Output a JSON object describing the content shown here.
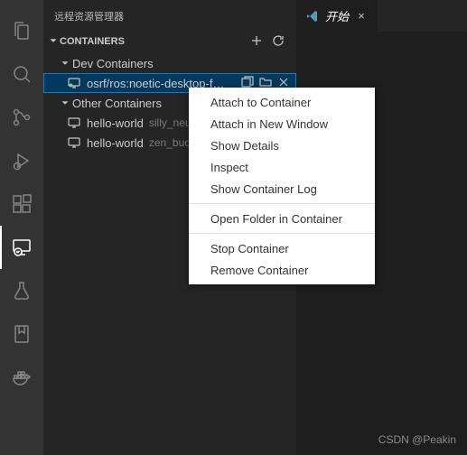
{
  "sidebar_title": "远程资源管理器",
  "section": {
    "title": "CONTAINERS",
    "groups": [
      {
        "label": "Dev Containers"
      },
      {
        "label": "Other Containers"
      }
    ],
    "dev_items": [
      {
        "label": "osrf/ros:noetic-desktop-f…"
      }
    ],
    "other_items": [
      {
        "label": "hello-world",
        "desc": "silly_neu"
      },
      {
        "label": "hello-world",
        "desc": "zen_buck"
      }
    ]
  },
  "tab": {
    "label": "开始"
  },
  "context_menu": {
    "items": [
      "Attach to Container",
      "Attach in New Window",
      "Show Details",
      "Inspect",
      "Show Container Log",
      "Open Folder in Container",
      "Stop Container",
      "Remove Container"
    ]
  },
  "watermark": "CSDN @Peakin"
}
